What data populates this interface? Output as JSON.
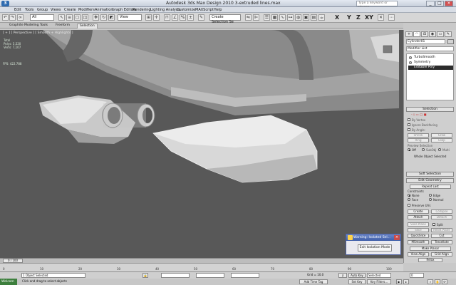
{
  "titlebar": {
    "app_logo": "3",
    "title": "Autodesk 3ds Max Design 2010     3-extruded lines.max",
    "search_placeholder": "Type a keyword or phrase",
    "min": "_",
    "max": "□",
    "close": "×"
  },
  "menu": [
    "Edit",
    "Tools",
    "Group",
    "Views",
    "Create",
    "Modifiers",
    "Animation",
    "Graph Editors",
    "Rendering",
    "Lighting Analysis",
    "Customize",
    "MAXScript",
    "Help"
  ],
  "toolbar": {
    "filter_value": "All",
    "coord_value": "View",
    "selection_set_value": "Create Selection Se",
    "axis_letters": [
      "X",
      "Y",
      "Z",
      "XY"
    ]
  },
  "ribbon": {
    "tabs": [
      "Graphite Modeling Tools",
      "Freeform",
      "Selection"
    ]
  },
  "viewport": {
    "label": "[ + ] [ Perspective ] [ Smooth + Highlights ]",
    "stats": [
      "Total",
      "Polys:  5,520",
      "Verts:  7,107"
    ],
    "fps": "FPS:   422.788",
    "background": "#585858"
  },
  "warning_dialog": {
    "title": "Warning: Isolated Sel...",
    "close": "×",
    "button": "Exit Isolation Mode"
  },
  "command_panel": {
    "tabs": [
      "+",
      "◠",
      "⊟",
      "◉",
      "▭",
      "✎"
    ],
    "object_name": "Cylinder01",
    "modifier_list": "Modifier List",
    "stack": [
      "TurboSmooth",
      "Symmetry",
      "Editable Poly"
    ],
    "rollouts": {
      "selection": "Selection",
      "soft_selection": "Soft Selection",
      "edit_geometry": "Edit Geometry"
    },
    "selection": {
      "by_vertex": "By Vertex",
      "ignore_backfacing": "Ignore Backfacing",
      "by_angle": "By Angle:",
      "shrink": "Shrink",
      "grow": "Grow",
      "ring": "Ring",
      "loop": "Loop",
      "preview_selection": "Preview Selection",
      "off": "Off",
      "subobj": "SubObj",
      "multi": "Multi",
      "status": "Whole Object Selected"
    },
    "edit_geometry": {
      "repeat_last": "Repeat Last",
      "constraints": "Constraints",
      "none": "None",
      "edge": "Edge",
      "face": "Face",
      "normal": "Normal",
      "preserve_uvs": "Preserve UVs",
      "create": "Create",
      "collapse": "Collapse",
      "attach": "Attach",
      "detach": "Detach",
      "slice_plane": "Slice Plane",
      "split": "Split",
      "slice": "Slice",
      "reset_plane": "Reset Plane",
      "quickslice": "QuickSlice",
      "cut": "Cut",
      "msmooth": "MSmooth",
      "tessellate": "Tessellate",
      "make_planar": "Make Planar",
      "view_align": "View Align",
      "grid_align": "Grid Align",
      "relax": "Relax"
    }
  },
  "timeline": {
    "slider": "0 / 100",
    "ticks": [
      "0",
      "10",
      "20",
      "30",
      "40",
      "50",
      "60",
      "70",
      "80",
      "90",
      "100"
    ]
  },
  "status": {
    "selected": "1 Object Selected",
    "prompt": "Click and drag to select objects",
    "x": "",
    "y": "",
    "z": "",
    "grid": "Grid = 10.0",
    "auto_key": "Auto Key",
    "selected_drop": "Selected",
    "set_key": "Set Key",
    "key_filters": "Key Filters...",
    "add_time_tag": "Add Time Tag",
    "frame": "0",
    "start": "Welcom"
  }
}
